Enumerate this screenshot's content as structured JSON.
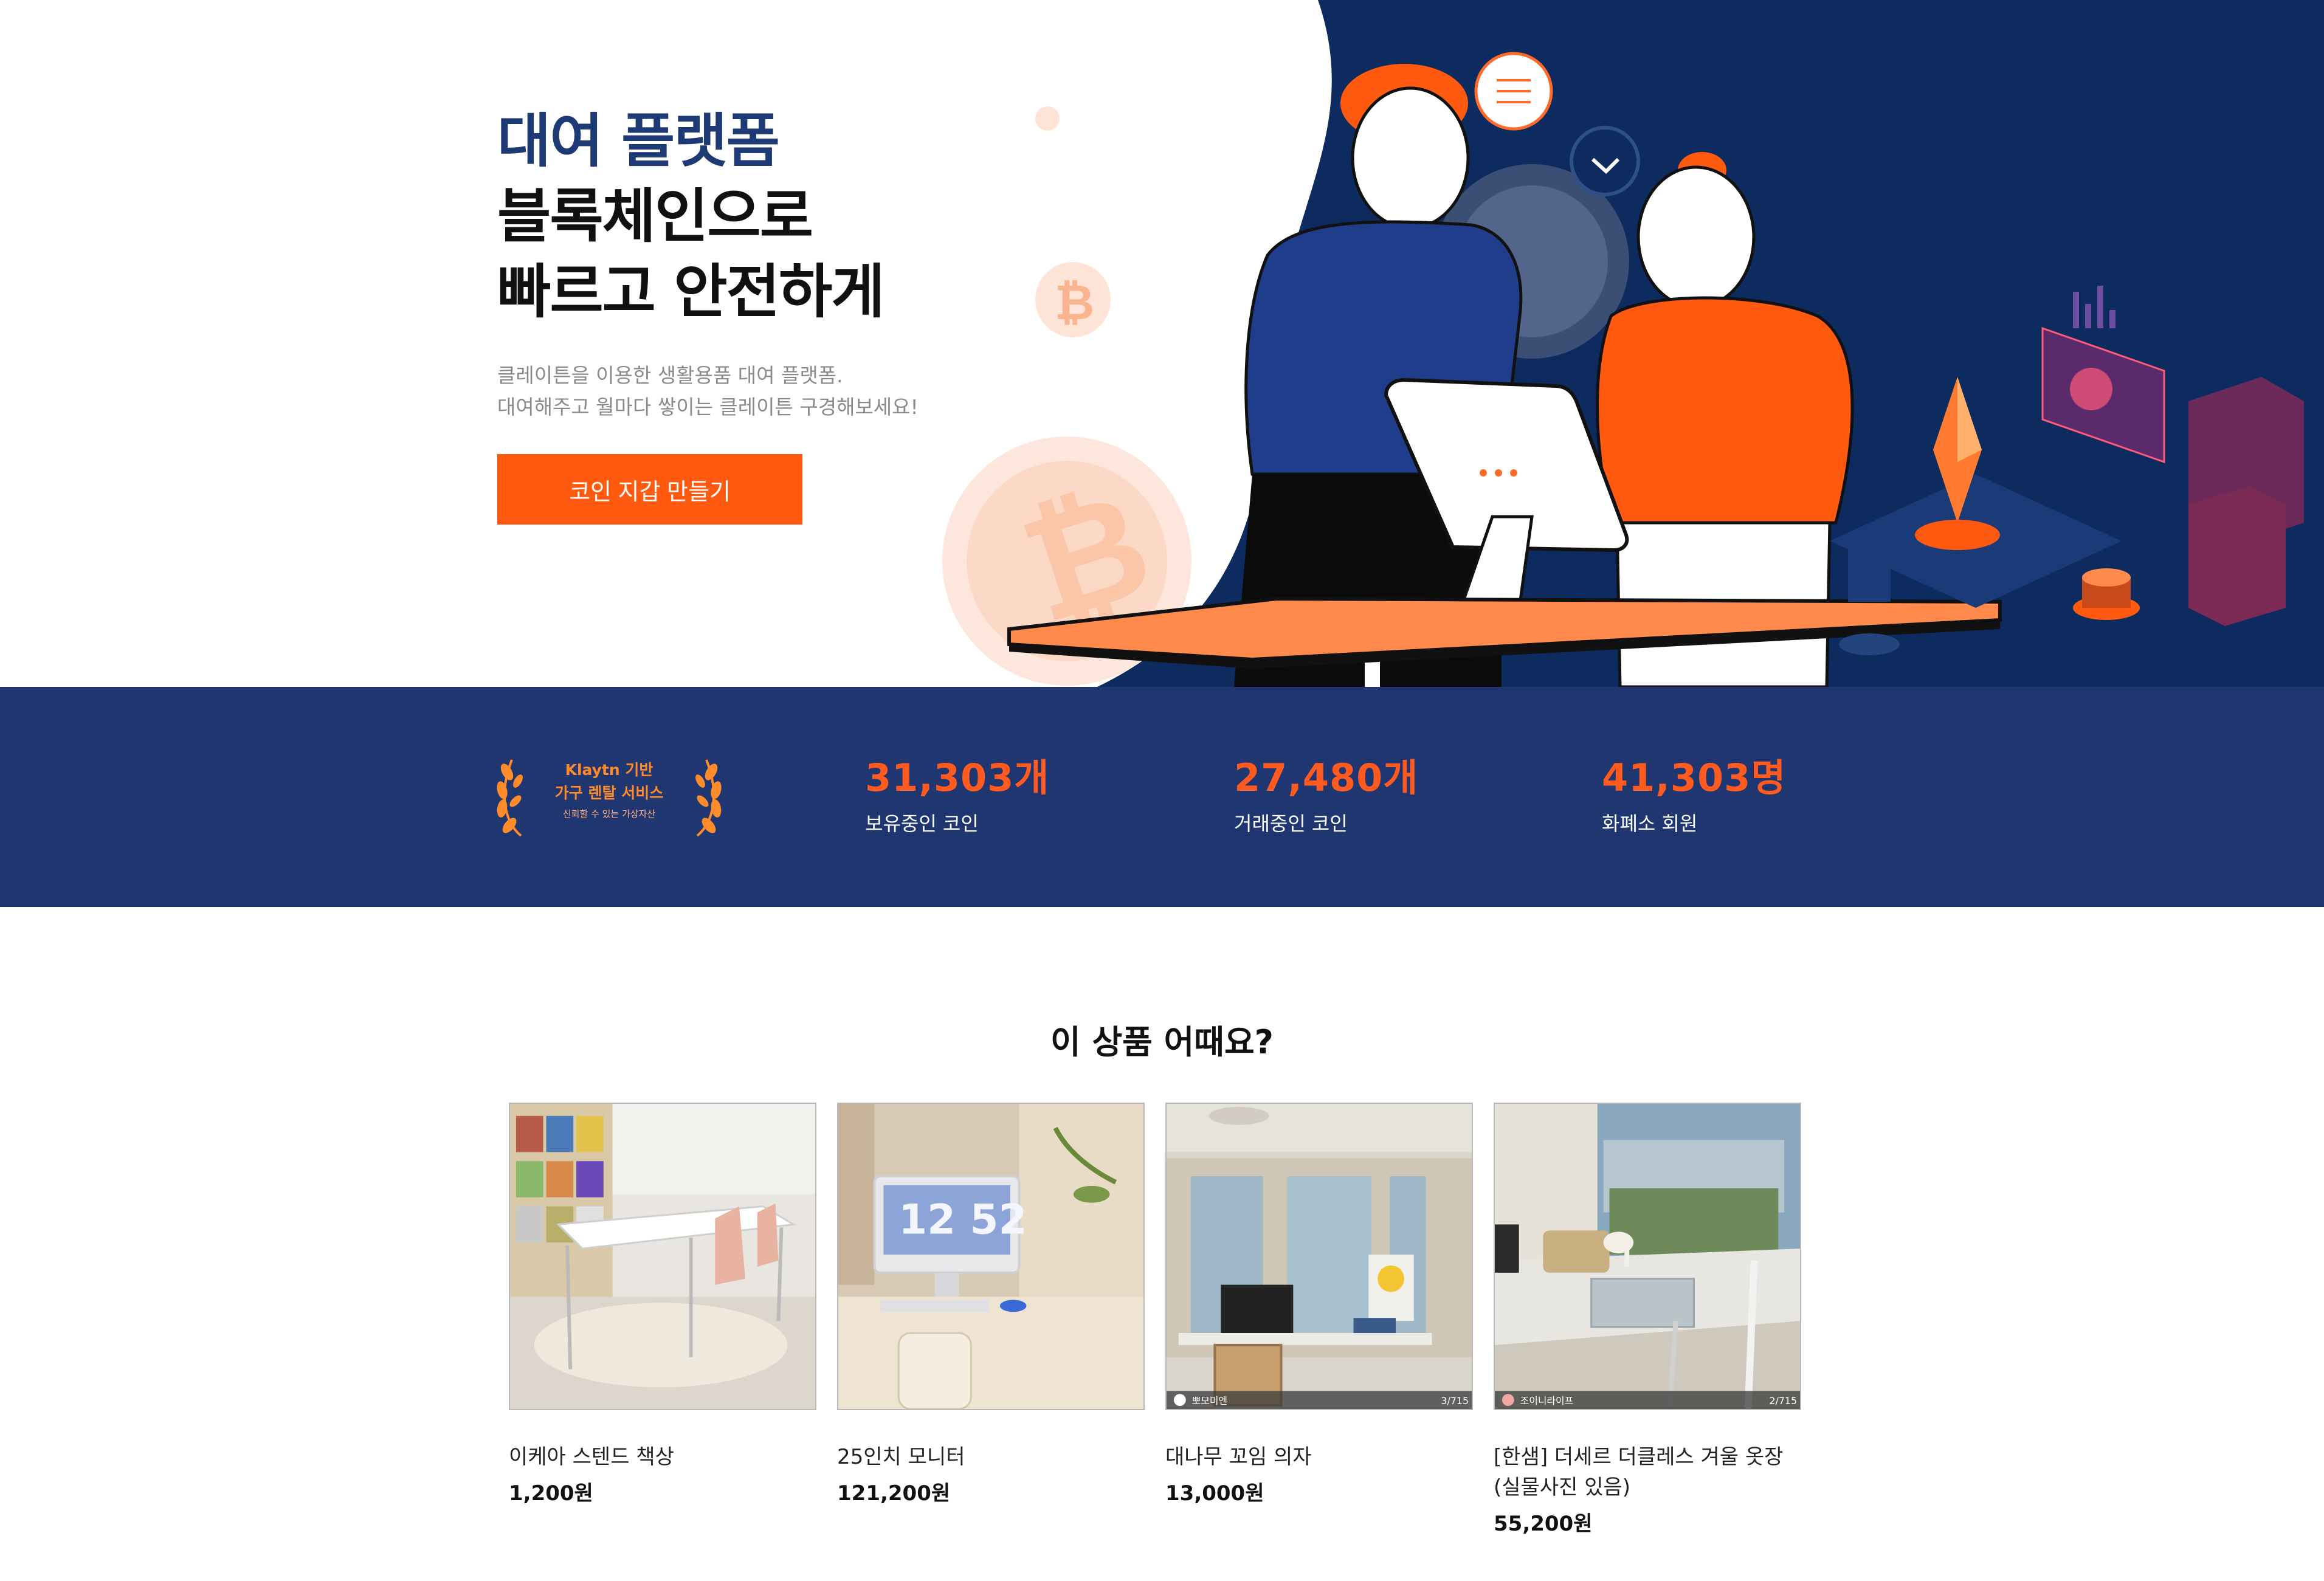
{
  "hero": {
    "headline": [
      "대여 플랫폼",
      "블록체인으로",
      "빠르고 안전하게"
    ],
    "description": [
      "클레이튼을 이용한 생활용품 대여 플랫폼.",
      "대여해주고 월마다 쌓이는 클레이튼 구경해보세요!"
    ],
    "cta_label": "코인 지갑 만들기",
    "colors": {
      "accent": "#ff5a0f",
      "navy": "#1f3670",
      "headline_accent": "#1e3a75"
    }
  },
  "stats": {
    "badge": {
      "line1": "Klaytn 기반",
      "line2": "가구 렌탈 서비스",
      "line3": "신뢰할 수 있는 가상자산"
    },
    "items": [
      {
        "value": "31,303개",
        "label": "보유중인 코인"
      },
      {
        "value": "27,480개",
        "label": "거래중인 코인"
      },
      {
        "value": "41,303명",
        "label": "화폐소 회원"
      }
    ]
  },
  "products": {
    "title": "이 상품 어때요?",
    "items": [
      {
        "name": "이케아 스텐드 책상",
        "price": "1,200원"
      },
      {
        "name": "25인치 모니터",
        "price": "121,200원",
        "screen_text": "12 52"
      },
      {
        "name": "대나무 꼬임 의자",
        "price": "13,000원",
        "overlay_user": "뽀모미엔",
        "overlay_count": "3/715"
      },
      {
        "name": "[한샘] 더세르 더클레스 겨울 옷장 (실물사진 있음)",
        "price": "55,200원",
        "overlay_user": "조이니라이프",
        "overlay_count": "2/715"
      }
    ]
  }
}
